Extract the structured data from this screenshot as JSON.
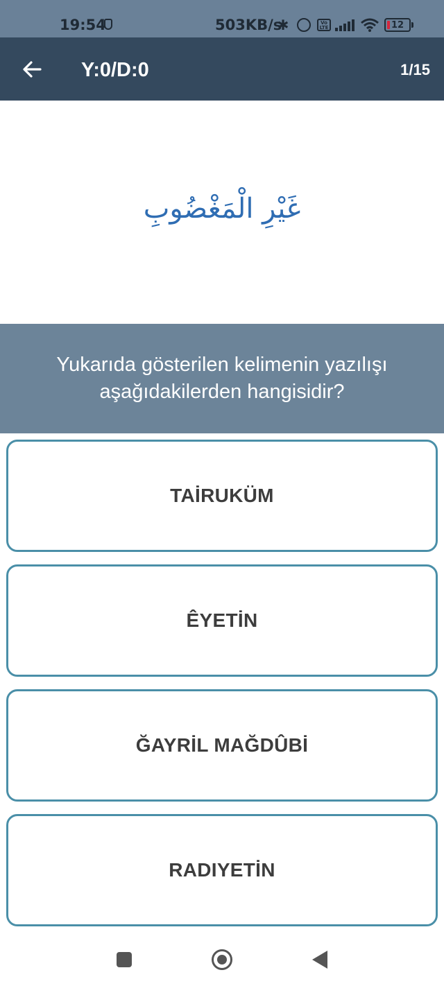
{
  "status_bar": {
    "time": "19:54",
    "network_speed": "503KB/s",
    "battery_level": "12",
    "icons": [
      "shield-icon",
      "bluetooth-icon",
      "alarm-icon",
      "volte-icon",
      "signal-icon",
      "wifi-icon",
      "battery-icon"
    ],
    "volte_label": "Vo LTE"
  },
  "app_bar": {
    "title": "Y:0/D:0",
    "counter": "1/15",
    "back_icon": "arrow-left-icon",
    "background": "#34495e"
  },
  "quiz": {
    "arabic_word": "غَيْرِ الْمَغْضُوبِ",
    "question": "Yukarıda gösterilen kelimenin yazılışı aşağıdakilerden hangisidir?",
    "options": [
      {
        "label": "TAİRUKÜM"
      },
      {
        "label": "ÊYETİN"
      },
      {
        "label": "ĞAYRİL MAĞDÛBİ"
      },
      {
        "label": "RADIYETİN"
      }
    ]
  },
  "nav_bar": {
    "icons": [
      "recents-square-icon",
      "home-circle-icon",
      "back-triangle-icon"
    ]
  },
  "colors": {
    "option_border": "#4a8fa8",
    "question_panel": "#6c8499",
    "arabic_text": "#2f6db3"
  }
}
